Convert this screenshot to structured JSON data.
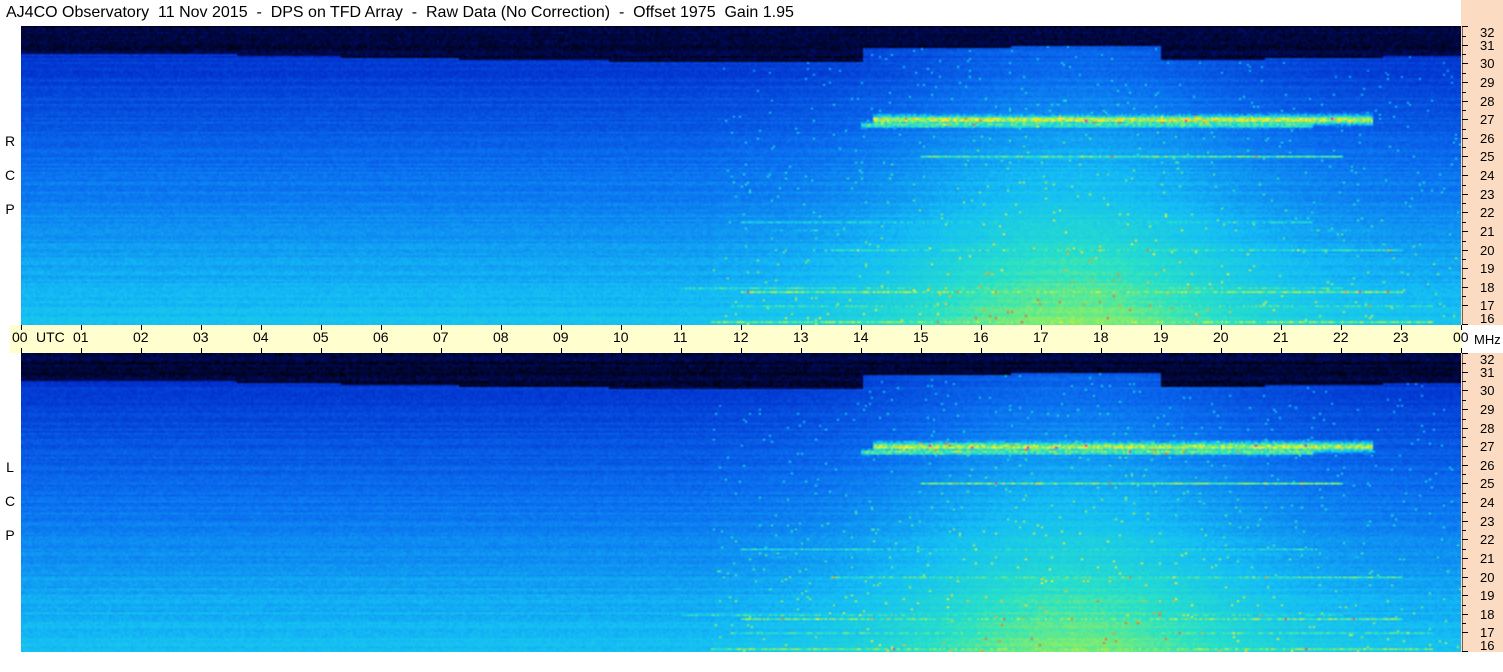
{
  "header": {
    "title": "AJ4CO Observatory  11 Nov 2015  -  DPS on TFD Array  -  Raw Data (No Correction)  -  Offset 1975  Gain 1.95"
  },
  "panels": {
    "rcp": {
      "label_letters": [
        "R",
        "C",
        "P"
      ]
    },
    "lcp": {
      "label_letters": [
        "L",
        "C",
        "P"
      ]
    }
  },
  "time_axis": {
    "utc_label": "UTC",
    "ticks": [
      "00",
      "01",
      "02",
      "03",
      "04",
      "05",
      "06",
      "07",
      "08",
      "09",
      "10",
      "11",
      "12",
      "13",
      "14",
      "15",
      "16",
      "17",
      "18",
      "19",
      "20",
      "21",
      "22",
      "23",
      "00"
    ]
  },
  "freq_axis": {
    "unit_label": "MHz",
    "labels": [
      "32",
      "31",
      "30",
      "29",
      "28",
      "27",
      "26",
      "25",
      "24",
      "23",
      "22",
      "21",
      "20",
      "19",
      "18",
      "17",
      "16"
    ]
  },
  "colors": {
    "background": "#ffffff",
    "time_axis_bg": "#fffecf",
    "freq_axis_bg": "#fbdcc2",
    "spectrogram_low": "#000000",
    "spectrogram_mid": "#0a55e6",
    "spectrogram_high": "#ff00ff"
  }
}
